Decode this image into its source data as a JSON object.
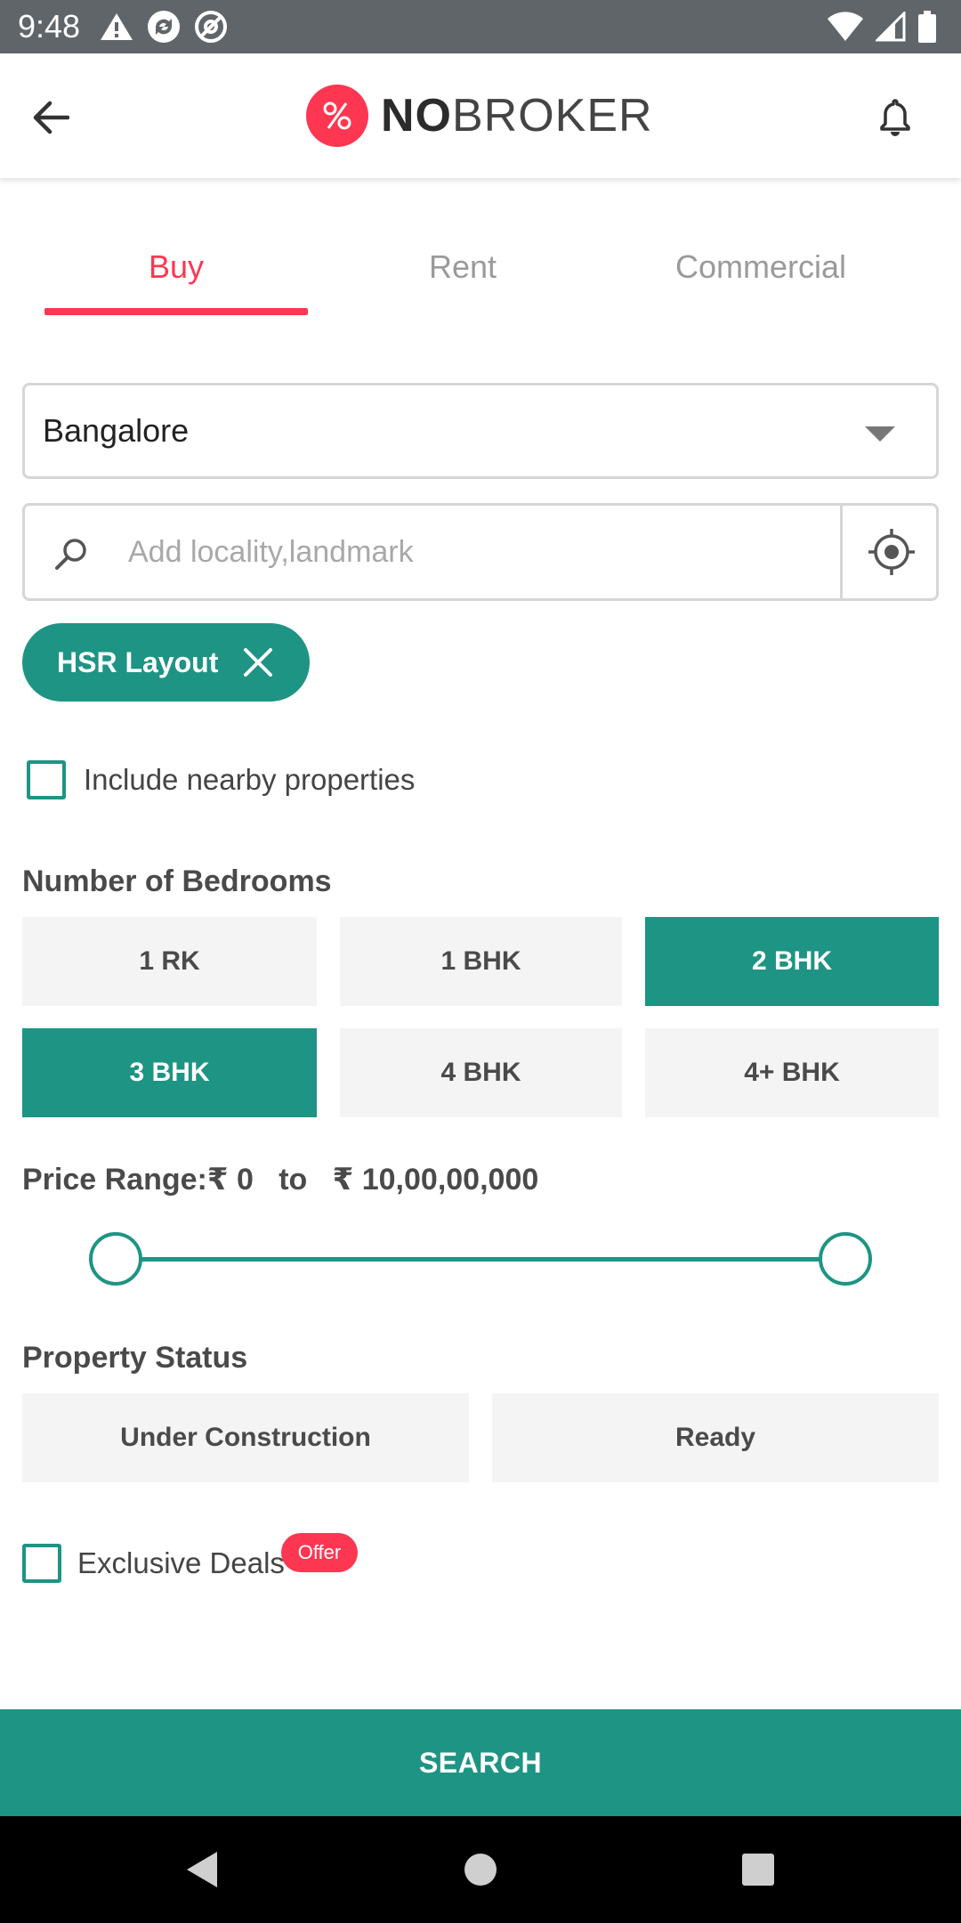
{
  "status_bar": {
    "time": "9:48",
    "left_icons": [
      "warning-icon",
      "sync-icon",
      "at-sign-icon"
    ],
    "right_icons": [
      "wifi-icon",
      "signal-icon",
      "battery-icon"
    ]
  },
  "app_bar": {
    "back_icon": "arrow-left-icon",
    "logo_bold": "NO",
    "logo_regular": "BROKER",
    "bell_icon": "bell-icon"
  },
  "tabs": [
    {
      "label": "Buy",
      "active": true
    },
    {
      "label": "Rent",
      "active": false
    },
    {
      "label": "Commercial",
      "active": false
    }
  ],
  "city": {
    "value": "Bangalore"
  },
  "search": {
    "placeholder": "Add locality,landmark",
    "value": ""
  },
  "chip": {
    "label": "HSR Layout"
  },
  "nearby": {
    "label": "Include nearby properties",
    "checked": false
  },
  "bedrooms": {
    "title": "Number of Bedrooms",
    "options": [
      {
        "label": "1 RK",
        "selected": false
      },
      {
        "label": "1 BHK",
        "selected": false
      },
      {
        "label": "2 BHK",
        "selected": true
      },
      {
        "label": "3 BHK",
        "selected": true
      },
      {
        "label": "4 BHK",
        "selected": false
      },
      {
        "label": "4+ BHK",
        "selected": false
      }
    ]
  },
  "price": {
    "text": "Price Range:₹ 0   to   ₹ 10,00,00,000",
    "min_fraction": 0,
    "max_fraction": 1
  },
  "property_status": {
    "title": "Property Status",
    "options": [
      {
        "label": "Under Construction",
        "selected": false
      },
      {
        "label": "Ready",
        "selected": false
      }
    ]
  },
  "exclusive": {
    "label": "Exclusive Deals",
    "badge": "Offer",
    "checked": false
  },
  "cta": {
    "label": "SEARCH"
  },
  "colors": {
    "accent": "#1e9484",
    "brand": "#fd3752"
  }
}
